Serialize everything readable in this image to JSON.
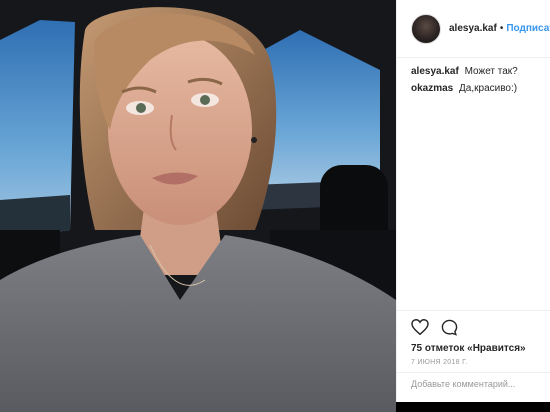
{
  "post": {
    "username": "alesya.kaf",
    "separator": "•",
    "follow_label": "Подписаться",
    "caption_author": "alesya.kaf",
    "caption_text": "Может так?",
    "comments": [
      {
        "author": "okazmas",
        "text": "Да,красиво:)"
      }
    ],
    "likes": "75 отметок «Нравится»",
    "date": "7 июня 2018 Г.",
    "add_comment_placeholder": "Добавьте комментарий..."
  },
  "icons": {
    "like": "heart-icon",
    "comment": "comment-icon"
  },
  "colors": {
    "link": "#3897f0",
    "text": "#262626",
    "muted": "#999999"
  }
}
